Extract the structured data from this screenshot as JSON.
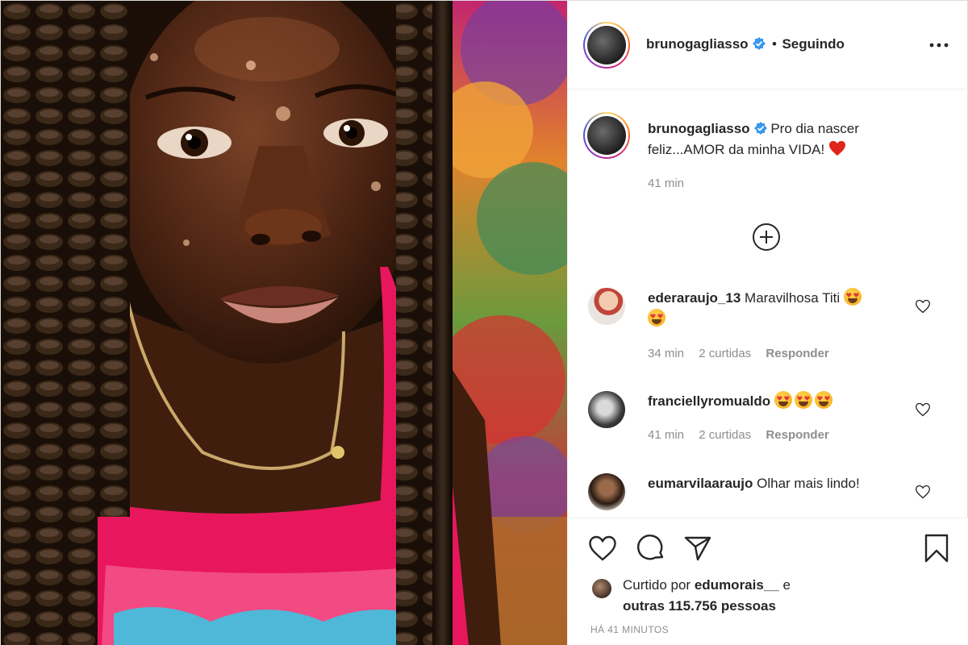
{
  "post": {
    "image_alt": "Close-up portrait of a girl with long braids wearing a pink top and a beaded necklace"
  },
  "header": {
    "username": "brunogagliasso",
    "separator": "•",
    "follow_status": "Seguindo",
    "avatar_icon": "user-avatar",
    "verified_icon": "verified-badge-icon",
    "more_icon": "more-options-icon"
  },
  "caption": {
    "username": "brunogagliasso",
    "text": "Pro dia nascer feliz...AMOR da minha VIDA!",
    "emoji": "❤️",
    "time": "41 min"
  },
  "comments": [
    {
      "username": "ederaraujo_13",
      "text": "Maravilhosa Titi",
      "emoji_count": 2,
      "time": "34 min",
      "likes": "2 curtidas",
      "reply": "Responder"
    },
    {
      "username": "franciellyromualdo",
      "text": "",
      "emoji_count": 3,
      "time": "41 min",
      "likes": "2 curtidas",
      "reply": "Responder"
    },
    {
      "username": "eumarvilaaraujo",
      "text": "Olhar mais lindo!",
      "emoji_count": 0
    }
  ],
  "actions": {
    "like_icon": "heart-icon",
    "comment_icon": "comment-icon",
    "share_icon": "share-icon",
    "save_icon": "bookmark-icon",
    "load_more_icon": "plus-circle-icon"
  },
  "likes": {
    "prefix": "Curtido por",
    "user": "edumorais__",
    "connector": "e",
    "others": "outras 115.756 pessoas"
  },
  "timestamp": "HÁ 41 MINUTOS",
  "colors": {
    "accent_blue": "#3897f0",
    "text": "#262626",
    "muted": "#8e8e8e",
    "border": "#efefef",
    "heart_red": "#ed4956"
  }
}
